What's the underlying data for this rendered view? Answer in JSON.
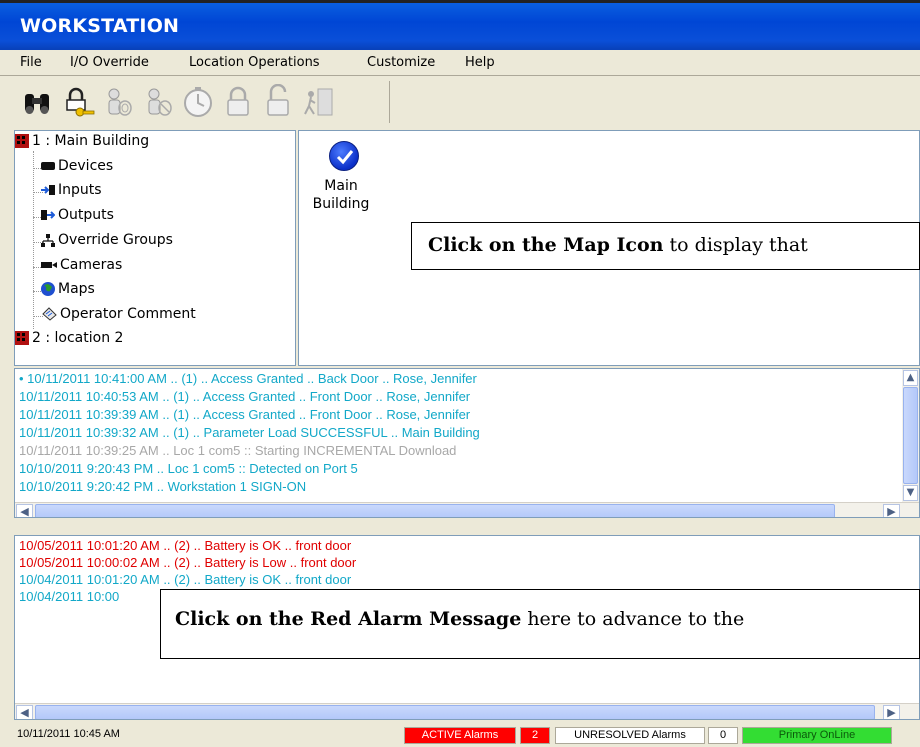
{
  "window": {
    "title": "WORKSTATION"
  },
  "menu": [
    "File",
    "I/O Override",
    "Location Operations",
    "Customize",
    "Help"
  ],
  "toolbar": {
    "buttons": [
      {
        "icon": "binoculars-icon"
      },
      {
        "icon": "key-lock-icon"
      },
      {
        "icon": "person-fingerprint-icon"
      },
      {
        "icon": "person-fingerprint-alt-icon"
      },
      {
        "icon": "clock-icon"
      },
      {
        "icon": "padlock-locked-icon"
      },
      {
        "icon": "padlock-unlocked-icon"
      },
      {
        "icon": "exit-door-icon"
      }
    ]
  },
  "tree": {
    "locations": [
      {
        "label": "1 :  Main Building"
      },
      {
        "label": "2 :  location 2"
      }
    ],
    "children": [
      {
        "label": "Devices",
        "icon": "device-icon"
      },
      {
        "label": "Inputs",
        "icon": "input-icon"
      },
      {
        "label": "Outputs",
        "icon": "output-icon"
      },
      {
        "label": "Override Groups",
        "icon": "override-groups-icon"
      },
      {
        "label": "Cameras",
        "icon": "camera-icon"
      },
      {
        "label": "Maps",
        "icon": "globe-icon"
      },
      {
        "label": "Operator Comment",
        "icon": "comment-icon"
      }
    ]
  },
  "map": {
    "icon_label_line1": "Main",
    "icon_label_line2": "Building",
    "callout_bold": "Click on the Map Icon",
    "callout_rest": " to display that"
  },
  "events": [
    {
      "text": "• 10/11/2011 10:41:00 AM .. (1) .. Access Granted .. Back Door .. Rose, Jennifer",
      "color": "#12a8c8"
    },
    {
      "text": "10/11/2011 10:40:53 AM .. (1) .. Access Granted .. Front Door .. Rose, Jennifer",
      "color": "#12a8c8"
    },
    {
      "text": "10/11/2011 10:39:39 AM .. (1) .. Access Granted .. Front Door .. Rose, Jennifer",
      "color": "#12a8c8"
    },
    {
      "text": "10/11/2011 10:39:32 AM .. (1) .. Parameter Load SUCCESSFUL .. Main Building",
      "color": "#12a8c8"
    },
    {
      "text": "10/11/2011 10:39:25 AM .. Loc 1  com5 :: Starting INCREMENTAL Download",
      "color": "#a8a8a8"
    },
    {
      "text": "10/10/2011 9:20:43 PM .. Loc 1  com5 :: Detected on Port 5",
      "color": "#12a8c8"
    },
    {
      "text": "10/10/2011 9:20:42 PM .. Workstation 1 SIGN-ON",
      "color": "#12a8c8"
    }
  ],
  "alarms": [
    {
      "text": "10/05/2011 10:01:20 AM .. (2) .. Battery is OK .. front door",
      "color": "#e00000"
    },
    {
      "text": "10/05/2011 10:00:02 AM .. (2) .. Battery is Low .. front door",
      "color": "#e00000"
    },
    {
      "text": "10/04/2011 10:01:20 AM .. (2) .. Battery is OK .. front door",
      "color": "#12a8c8"
    },
    {
      "text": "10/04/2011 10:00",
      "color": "#12a8c8"
    }
  ],
  "alarm_callout": {
    "bold": "Click on the Red Alarm Message",
    "rest": " here to advance to the"
  },
  "status": {
    "datetime": "10/11/2011 10:45 AM",
    "active_label": "ACTIVE Alarms",
    "active_count": "2",
    "unresolved_label": "UNRESOLVED Alarms",
    "unresolved_count": "0",
    "online": "Primary OnLine"
  },
  "colors": {
    "titlebar": "#0046d5",
    "active_alarm_bg": "#ff0000",
    "online_bg": "#33dd33",
    "event_cyan": "#12a8c8",
    "alarm_red": "#e00000"
  }
}
